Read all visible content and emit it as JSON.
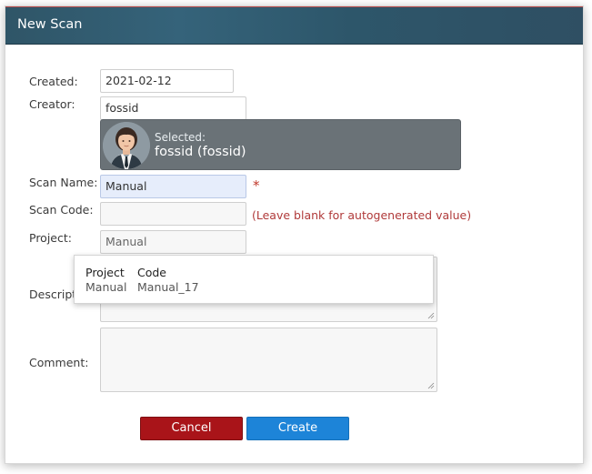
{
  "dialog": {
    "title": "New Scan"
  },
  "form": {
    "created_label": "Created:",
    "created_value": "2021-02-12",
    "creator_label": "Creator:",
    "creator_value": "fossid",
    "selected_caption": "Selected:",
    "selected_name": "fossid (fossid)",
    "scan_name_label": "Scan Name:",
    "scan_name_value": "Manual",
    "required_mark": "*",
    "scan_code_label": "Scan Code:",
    "scan_code_value": "",
    "scan_code_hint": "(Leave blank for autogenerated value)",
    "project_label": "Project:",
    "project_value": "Manual",
    "description_label": "Descript",
    "comment_label": "Comment:"
  },
  "project_dropdown": {
    "headers": [
      "Project",
      "Code"
    ],
    "rows": [
      [
        "Manual",
        "Manual_17"
      ]
    ]
  },
  "buttons": {
    "cancel_label": "Cancel",
    "create_label": "Create"
  },
  "colors": {
    "titlebar": "#2f5567",
    "cancel": "#a91419",
    "create": "#1d84d8",
    "hint": "#b03a3a",
    "selected_panel": "#6a7277"
  },
  "icons": {
    "avatar": "user-avatar-icon",
    "resize": "resize-grip-icon"
  }
}
